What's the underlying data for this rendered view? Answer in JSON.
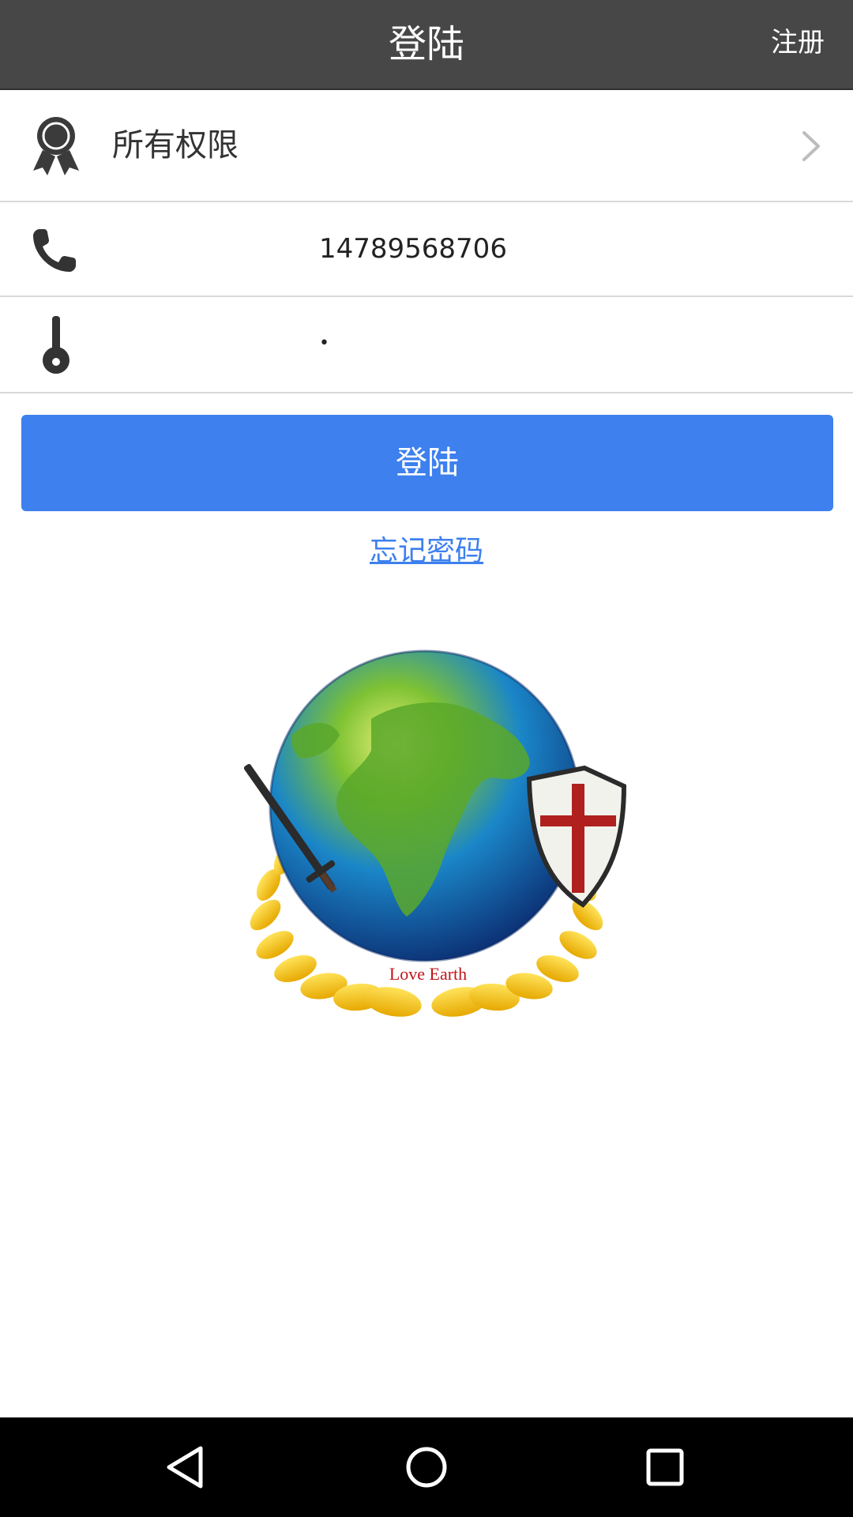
{
  "appbar": {
    "title": "登陆",
    "register_label": "注册"
  },
  "permission_row": {
    "label": "所有权限",
    "icon": "award-ribbon-icon"
  },
  "phone_row": {
    "icon": "phone-icon",
    "value": "14789568706"
  },
  "password_row": {
    "icon": "key-icon",
    "value": "•"
  },
  "login_button": {
    "label": "登陆",
    "color": "#3d80ee"
  },
  "forgot_password": {
    "label": "忘记密码"
  },
  "logo": {
    "caption": "Love Earth"
  },
  "navbar": {
    "back_icon": "back-triangle-icon",
    "home_icon": "home-circle-icon",
    "recents_icon": "recents-square-icon"
  },
  "colors": {
    "appbar": "#474747",
    "accent": "#3d80ee",
    "navbar": "#000000"
  }
}
